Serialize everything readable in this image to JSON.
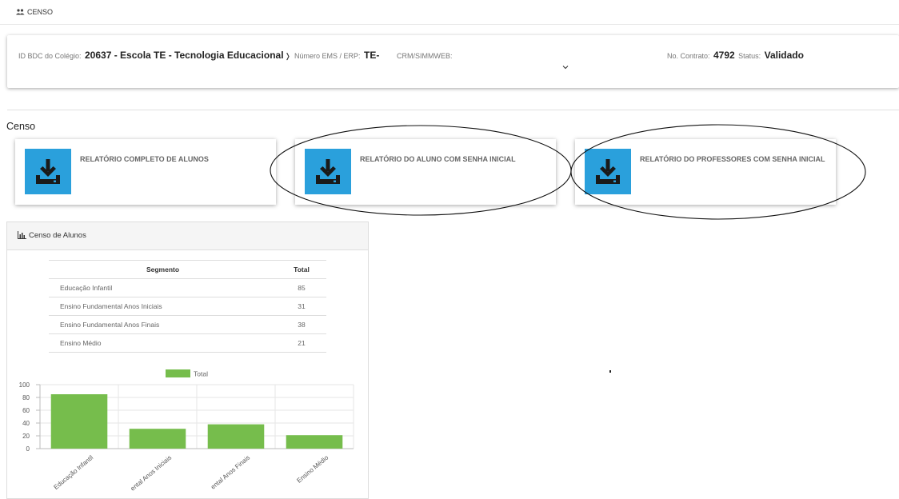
{
  "breadcrumb": {
    "icon": "users-icon",
    "label": "CENSO"
  },
  "school_info": {
    "id_label": "ID BDC do Colégio:",
    "id_value": "20637 - Escola TE - Tecnologia Educacional",
    "ems_label": "Número EMS / ERP:",
    "ems_value": "TE-",
    "crm_label": "CRM/SIMMWEB:",
    "crm_value": "",
    "contract_label": "No. Contrato:",
    "contract_value": "4792",
    "status_label": "Status:",
    "status_value": "Validado"
  },
  "section_title": "Censo",
  "reports": [
    {
      "label": "RELATÓRIO COMPLETO DE ALUNOS",
      "icon": "download-icon"
    },
    {
      "label": "RELATÓRIO DO ALUNO COM SENHA INICIAL",
      "icon": "download-icon"
    },
    {
      "label": "RELATÓRIO DO PROFESSORES COM SENHA INICIAL",
      "icon": "download-icon"
    }
  ],
  "census_panel": {
    "title": "Censo de Alunos",
    "icon": "bar-chart-icon",
    "table": {
      "headers": [
        "Segmento",
        "Total"
      ],
      "rows": [
        [
          "Educação Infantil",
          "85"
        ],
        [
          "Ensino Fundamental Anos Iniciais",
          "31"
        ],
        [
          "Ensino Fundamental Anos Finais",
          "38"
        ],
        [
          "Ensino Médio",
          "21"
        ]
      ]
    }
  },
  "colors": {
    "accent": "#2aa0dc",
    "bar": "#76bd4c"
  },
  "chart_data": {
    "type": "bar",
    "categories": [
      "Educação Infantil",
      "Ensino Fundamental Anos Iniciais",
      "Ensino Fundamental Anos Finais",
      "Ensino Médio"
    ],
    "category_labels_visible": [
      "Educação Infantil",
      "ental Anos Iniciais",
      "ental Anos Finais",
      "Ensino Médio"
    ],
    "series": [
      {
        "name": "Total",
        "values": [
          85,
          31,
          38,
          21
        ]
      }
    ],
    "ylim": [
      0,
      100
    ],
    "yticks": [
      0,
      20,
      40,
      60,
      80,
      100
    ],
    "legend": "top-center",
    "grid": true
  }
}
